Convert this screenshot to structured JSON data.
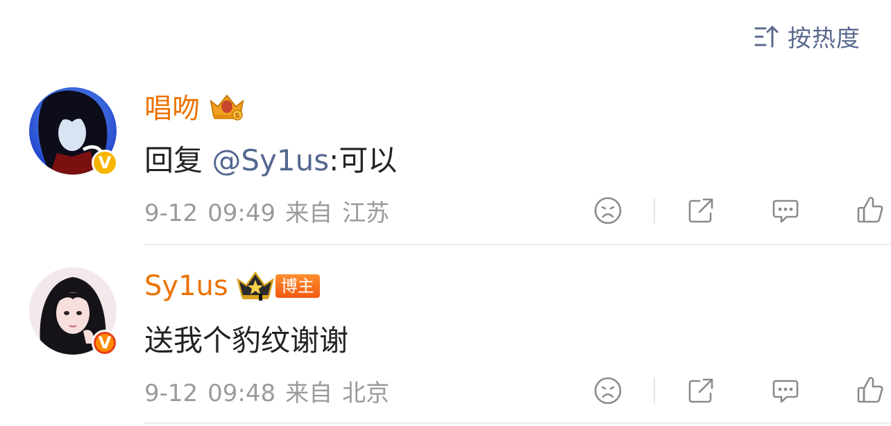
{
  "sort": {
    "label": "按热度",
    "icon": "sort-up-icon"
  },
  "comments": [
    {
      "name": "唱吻",
      "name_badge": "crown-s-icon",
      "verified_color": "#f7b500",
      "verified_letter": "V",
      "text_prefix": "回复 ",
      "mention": "@Sy1us",
      "text_suffix": ":可以",
      "date": "9-12",
      "time": "09:49",
      "from": "来自",
      "location": "江苏"
    },
    {
      "name": "Sy1us",
      "name_badge": "crown-star-icon",
      "role_badge": "博主",
      "verified_color": "#ff8a00",
      "verified_letter": "V",
      "text": "送我个豹纹谢谢",
      "date": "9-12",
      "time": "09:48",
      "from": "来自",
      "location": "北京"
    }
  ],
  "colors": {
    "name": "#eb7200",
    "mention": "#53678f",
    "meta": "#9a9a9a",
    "icon": "#8a8a8a"
  }
}
